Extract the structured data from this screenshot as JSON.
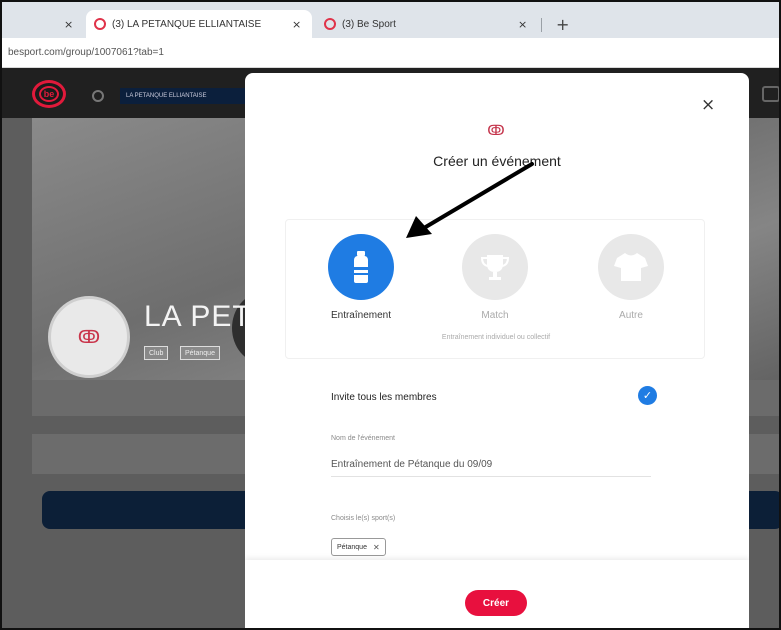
{
  "browser": {
    "tabs": [
      {
        "title": "",
        "close": "×"
      },
      {
        "title": "(3) LA PETANQUE ELLIANTAISE",
        "close": "×"
      },
      {
        "title": "(3) Be Sport",
        "close": "×"
      }
    ],
    "new_tab": "+",
    "url": "besport.com/group/1007061?tab=1"
  },
  "site": {
    "logo_text": "be",
    "group_chip": "LA PETANQUE ELLIANTAISE",
    "group_title": "LA PET",
    "pills": [
      "Club",
      "Pétanque"
    ]
  },
  "modal": {
    "close": "×",
    "title": "Créer un événement",
    "types": [
      {
        "label": "Entraînement",
        "active": true
      },
      {
        "label": "Match",
        "active": false
      },
      {
        "label": "Autre",
        "active": false
      }
    ],
    "type_description": "Entraînement individuel ou collectif",
    "invite_label": "Invite tous les membres",
    "invite_checked": true,
    "event_name_label": "Nom de l'événement",
    "event_name_value": "Entraînement de Pétanque du 09/09",
    "sports_label": "Choisis le(s) sport(s)",
    "sport_chip": "Pétanque",
    "sport_chip_remove": "✕",
    "create_button": "Créer"
  },
  "colors": {
    "accent_blue": "#1f7ce3",
    "brand_red": "#e8103e",
    "header_dark": "#0c1f37"
  }
}
